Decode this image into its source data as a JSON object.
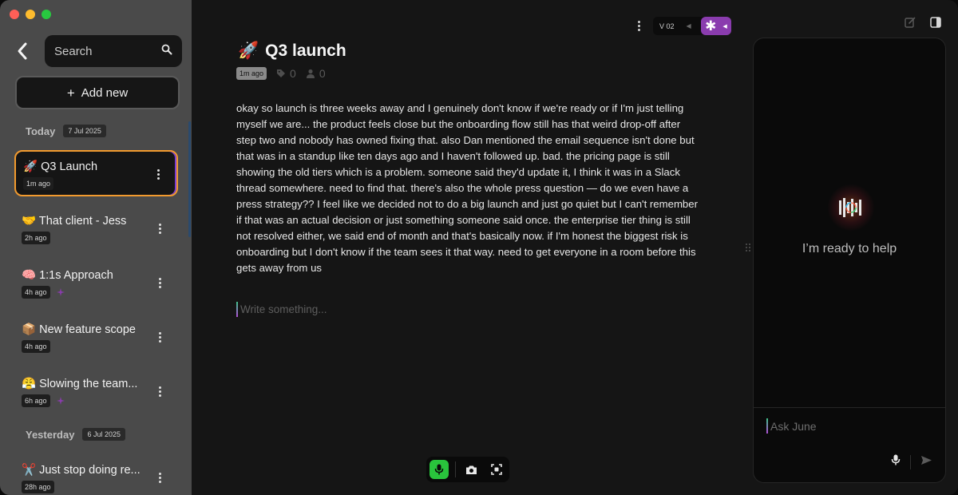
{
  "sidebar": {
    "search_placeholder": "Search",
    "add_new_label": "Add new",
    "sections": [
      {
        "label": "Today",
        "date": "7 Jul 2025"
      },
      {
        "label": "Yesterday",
        "date": "6 Jul 2025"
      }
    ],
    "notes": [
      {
        "emoji": "🚀",
        "title": "Q3 Launch",
        "time": "1m ago",
        "ai": false,
        "active": true
      },
      {
        "emoji": "🤝",
        "title": "That client - Jess",
        "time": "2h ago",
        "ai": false,
        "active": false
      },
      {
        "emoji": "🧠",
        "title": "1:1s Approach",
        "time": "4h ago",
        "ai": true,
        "active": false
      },
      {
        "emoji": "📦",
        "title": "New feature scope",
        "time": "4h ago",
        "ai": false,
        "active": false
      },
      {
        "emoji": "😤",
        "title": "Slowing the team...",
        "time": "6h ago",
        "ai": true,
        "active": false
      },
      {
        "emoji": "✂️",
        "title": "Just stop doing re...",
        "time": "28h ago",
        "ai": false,
        "active": false
      }
    ]
  },
  "editor": {
    "version_label": "V 02",
    "title_emoji": "🚀",
    "title": "Q3 launch",
    "time_ago": "1m ago",
    "tag_count": "0",
    "people_count": "0",
    "body": "okay so launch is three weeks away and I genuinely don't know if we're ready or if I'm just telling myself we are... the product feels close but the onboarding flow still has that weird drop-off after step two and nobody has owned fixing that. also Dan mentioned the email sequence isn't done but that was in a standup like ten days ago and I haven't followed up. bad. the pricing page is still showing the old tiers which is a problem. someone said they'd update it, I think it was in a Slack thread somewhere. need to find that. there's also the whole press question — do we even have a press strategy?? I feel like we decided not to do a big launch and just go quiet but I can't remember if that was an actual decision or just something someone said once. the enterprise tier thing is still not resolved either, we said end of month and that's basically now. if I'm honest the biggest risk is onboarding but I don't know if the team sees it that way. need to get everyone in a room before this gets away from us",
    "write_placeholder": "Write something..."
  },
  "assistant": {
    "ready_text": "I’m ready to help",
    "ask_placeholder": "Ask June"
  },
  "colors": {
    "sidebar_bg": "#4a4a4a",
    "active_border": "#f29a2e",
    "ai_purple": "#8a3cae",
    "mic_green": "#29c43c"
  }
}
